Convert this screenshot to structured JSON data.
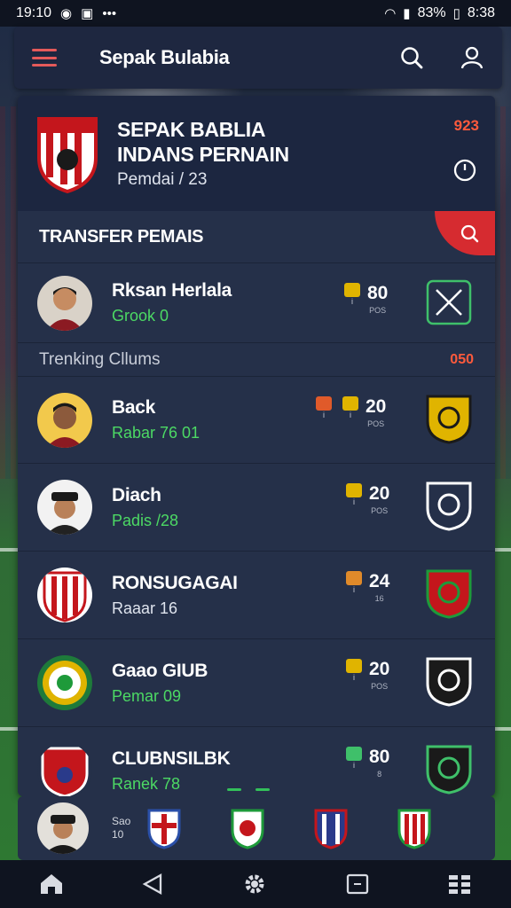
{
  "status_bar": {
    "time": "19:10",
    "battery_percent": "83%",
    "clock_right": "8:38"
  },
  "app_bar": {
    "title": "Sepak Bulabia"
  },
  "hero": {
    "title_line1": "SEPAK BABLIA",
    "title_line2": "INDANS PERNAIN",
    "subtitle": "Pemdai / 23",
    "count": "923"
  },
  "transfer_section": {
    "title": "TRANSFER PEMAIS"
  },
  "player_row": {
    "name": "Rksan Herlala",
    "sub": "Grook 0",
    "stat_value": "80",
    "stat_caption": "POS"
  },
  "tracking": {
    "title": "Trenking Cllums",
    "count": "050"
  },
  "club_rows": [
    {
      "name": "Back",
      "sub": "Rabar 76 01",
      "stat_value": "20",
      "stat_caption": "POS",
      "sub_color": "#4cd964"
    },
    {
      "name": "Diach",
      "sub": "Padis /28",
      "stat_value": "20",
      "stat_caption": "POS",
      "sub_color": "#4cd964"
    },
    {
      "name": "RONSUGAGAI",
      "sub": "Raaar 16",
      "stat_value": "24",
      "stat_caption": "16",
      "sub_color": "#dfe4ee"
    },
    {
      "name": "Gaao GIUB",
      "sub": "Pemar 09",
      "stat_value": "20",
      "stat_caption": "POS",
      "sub_color": "#4cd964"
    },
    {
      "name": "CLUBNSILBK",
      "sub": "Ranek 78",
      "stat_value": "80",
      "stat_caption": "8",
      "sub_color": "#4cd964"
    }
  ],
  "bottom_strip": {
    "meta_line1": "Sao",
    "meta_line2": "10"
  },
  "colors": {
    "accent_red": "#d62b30",
    "accent_green": "#4cd964",
    "card_bg": "#253049",
    "count_orange": "#ff5a3c"
  },
  "icons": [
    "menu-icon",
    "search-icon",
    "user-icon",
    "clock-icon",
    "home-icon",
    "back-icon",
    "settings-icon",
    "recent-apps-icon",
    "grid-icon"
  ]
}
